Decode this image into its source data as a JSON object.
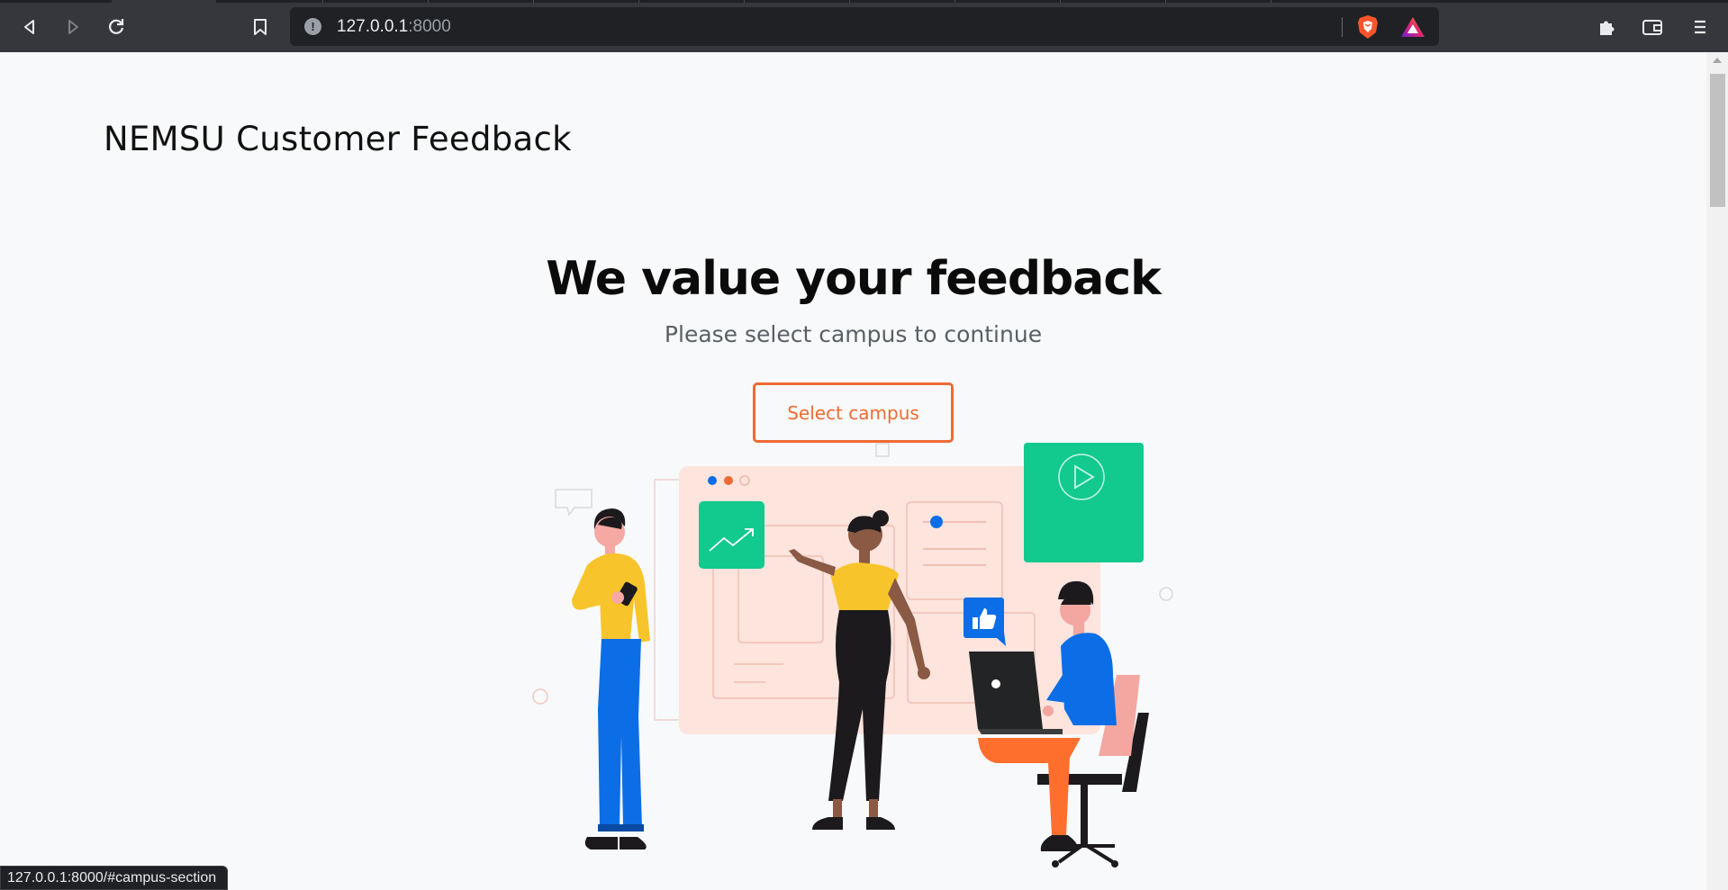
{
  "browser": {
    "url_host": "127.0.0.1",
    "url_port": ":8000",
    "status_url": "127.0.0.1:8000/#campus-section"
  },
  "page": {
    "brand": "NEMSU Customer Feedback",
    "hero_title": "We value your feedback",
    "hero_subtitle": "Please select campus to continue",
    "cta_label": "Select campus"
  },
  "colors": {
    "accent": "#ef6b34",
    "green": "#12c98e",
    "blue": "#0b6ee6",
    "yellow": "#f7c52b",
    "board": "#fde4dd"
  },
  "icons": [
    "back-icon",
    "forward-icon",
    "reload-icon",
    "bookmark-icon",
    "site-info-icon",
    "brave-shield-icon",
    "brave-rewards-icon",
    "extensions-icon",
    "wallet-icon",
    "menu-icon"
  ]
}
